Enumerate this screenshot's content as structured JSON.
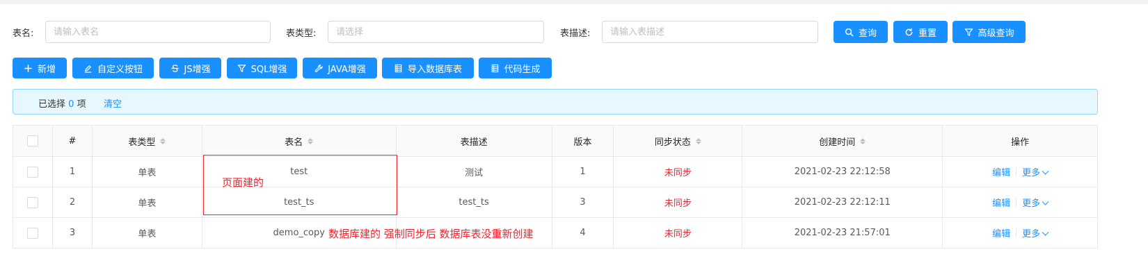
{
  "search": {
    "table_name_label": "表名:",
    "table_name_placeholder": "请输入表名",
    "table_type_label": "表类型:",
    "table_type_placeholder": "请选择",
    "table_desc_label": "表描述:",
    "table_desc_placeholder": "请输入表描述",
    "query_label": "查询",
    "reset_label": "重置",
    "advanced_query_label": "高级查询"
  },
  "toolbar": {
    "add_label": "新增",
    "custom_button_label": "自定义按钮",
    "js_enhance_label": "JS增强",
    "sql_enhance_label": "SQL增强",
    "java_enhance_label": "JAVA增强",
    "import_db_table_label": "导入数据库表",
    "code_gen_label": "代码生成"
  },
  "selection": {
    "prefix": "已选择",
    "count": "0",
    "suffix": "项",
    "clear_label": "清空"
  },
  "table": {
    "headers": {
      "index": "#",
      "type": "表类型",
      "name": "表名",
      "desc": "表描述",
      "version": "版本",
      "sync": "同步状态",
      "created": "创建时间",
      "actions": "操作"
    },
    "rows": [
      {
        "index": "1",
        "type": "单表",
        "name": "test",
        "desc": "测试",
        "version": "1",
        "sync": "未同步",
        "created": "2021-02-23 22:12:58",
        "edit": "编辑",
        "more": "更多"
      },
      {
        "index": "2",
        "type": "单表",
        "name": "test_ts",
        "desc": "test_ts",
        "version": "3",
        "sync": "未同步",
        "created": "2021-02-23 22:12:11",
        "edit": "编辑",
        "more": "更多"
      },
      {
        "index": "3",
        "type": "单表",
        "name": "demo_copy",
        "desc": "",
        "version": "4",
        "sync": "未同步",
        "created": "2021-02-23 21:57:01",
        "edit": "编辑",
        "more": "更多"
      }
    ]
  },
  "annotations": {
    "page_built": "页面建的",
    "db_built": "数据库建的 强制同步后 数据库表没重新创建"
  },
  "colors": {
    "primary": "#1890ff",
    "danger": "#f5222d",
    "alert_bg": "#e6f7ff"
  }
}
